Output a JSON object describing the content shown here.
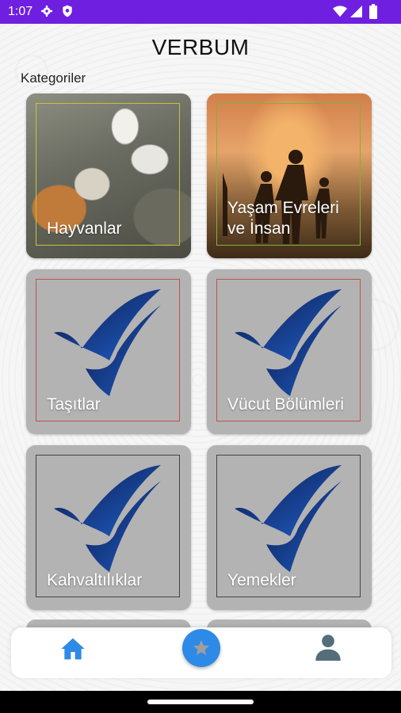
{
  "status_bar": {
    "time": "1:07",
    "icons": [
      "gear-icon",
      "shield-icon",
      "wifi-icon",
      "signal-icon",
      "battery-icon"
    ],
    "color": "#6f1fe0"
  },
  "app": {
    "title": "VERBUM"
  },
  "section": {
    "label": "Kategoriler"
  },
  "categories": [
    {
      "label": "Hayvanlar",
      "image": "animals-photo",
      "frame_color": "#c9c23a"
    },
    {
      "label": "Yaşam Evreleri ve İnsan",
      "image": "family-sunset-photo",
      "frame_color": "#7fb23a"
    },
    {
      "label": "Taşıtlar",
      "image": "verbum-logo",
      "frame_color": "#c0504d"
    },
    {
      "label": "Vücut Bölümleri",
      "image": "verbum-logo",
      "frame_color": "#c0504d"
    },
    {
      "label": "Kahvaltılıklar",
      "image": "verbum-logo",
      "frame_color": "#444444"
    },
    {
      "label": "Yemekler",
      "image": "verbum-logo",
      "frame_color": "#444444"
    }
  ],
  "bottom_nav": {
    "items": [
      "home-icon",
      "favorites-star-icon",
      "profile-icon"
    ],
    "accent": "#2d8ae6"
  },
  "colors": {
    "card_bg": "#b3b3b3",
    "logo_dark": "#0d1a4a",
    "logo_light": "#1f5fc9"
  }
}
